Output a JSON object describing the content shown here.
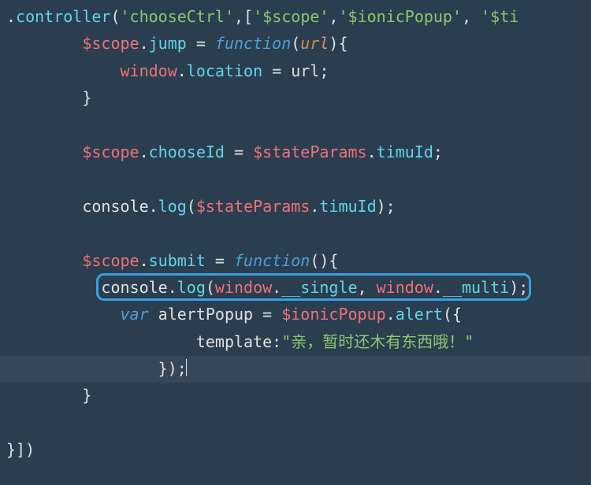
{
  "code": {
    "l1_dot": ".",
    "l1_controller": "controller",
    "l1_paren_open": "(",
    "l1_str1": "'chooseCtrl'",
    "l1_comma1": ",[",
    "l1_str2": "'$scope'",
    "l1_comma2": ",",
    "l1_str3": "'$ionicPopup'",
    "l1_comma3": ", ",
    "l1_str4": "'$ti",
    "l2_indent": "        ",
    "l2_scope": "$scope",
    "l2_dot": ".",
    "l2_jump": "jump",
    "l2_eq": " = ",
    "l2_func": "function",
    "l2_po": "(",
    "l2_url": "url",
    "l2_pc": "){",
    "l3_indent": "            ",
    "l3_window": "window",
    "l3_dot": ".",
    "l3_location": "location",
    "l3_eq": " = url;",
    "l4_indent": "        ",
    "l4_brace": "}",
    "l6_indent": "        ",
    "l6_scope": "$scope",
    "l6_dot": ".",
    "l6_chooseId": "chooseId",
    "l6_eq": " = ",
    "l6_sp": "$stateParams",
    "l6_dot2": ".",
    "l6_timuId": "timuId",
    "l6_semi": ";",
    "l8_indent": "        ",
    "l8_console": "console.",
    "l8_log": "log",
    "l8_po": "(",
    "l8_sp": "$stateParams",
    "l8_dot": ".",
    "l8_timuId": "timuId",
    "l8_pc": ");",
    "l10_indent": "        ",
    "l10_scope": "$scope",
    "l10_dot": ".",
    "l10_submit": "submit",
    "l10_eq": " = ",
    "l10_func": "function",
    "l10_parens": "(){",
    "l11_indent": "          ",
    "l11_console": "console.",
    "l11_log": "log",
    "l11_po": "(",
    "l11_window1": "window",
    "l11_dot1": ".",
    "l11_single": "__single",
    "l11_comma": ", ",
    "l11_window2": "window",
    "l11_dot2": ".",
    "l11_multi": "__multi",
    "l11_pc": ");",
    "l12_indent": "            ",
    "l12_var": "var",
    "l12_sp": " alertPopup = ",
    "l12_ip": "$ionicPopup",
    "l12_dot": ".",
    "l12_alert": "alert",
    "l12_po": "({",
    "l13_indent": "                    ",
    "l13_template": "template",
    "l13_colon": ":",
    "l13_str": "\"亲，暂时还木有东西哦！\"",
    "l14_indent": "                ",
    "l14_close": "});",
    "l15_indent": "        ",
    "l15_brace": "}",
    "l17_close": "}])"
  }
}
